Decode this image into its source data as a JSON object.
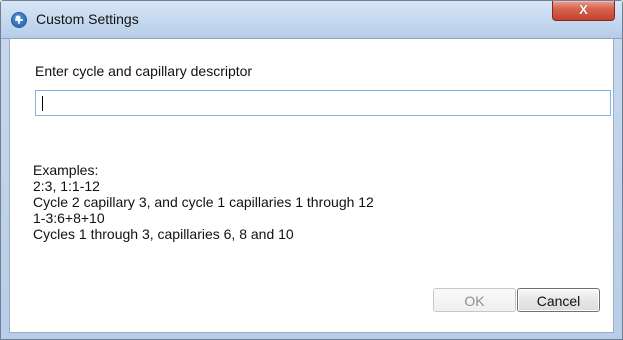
{
  "window": {
    "title": "Custom Settings",
    "close_glyph": "X",
    "icon": "app-icon"
  },
  "form": {
    "prompt_label": "Enter cycle and capillary descriptor",
    "input_value": "",
    "examples_heading": "Examples:",
    "example_lines": [
      "2:3, 1:1-12",
      "Cycle 2 capillary 3, and cycle 1 capillaries 1 through 12",
      "1-3:6+8+10",
      "Cycles 1 through 3, capillaries 6, 8 and 10"
    ]
  },
  "buttons": {
    "ok_label": "OK",
    "cancel_label": "Cancel",
    "ok_enabled": false
  },
  "colors": {
    "title_bar": "#c5d8ef",
    "close_button": "#d86551",
    "input_border": "#7eb4ea",
    "disabled_text": "#8f8f8f"
  }
}
